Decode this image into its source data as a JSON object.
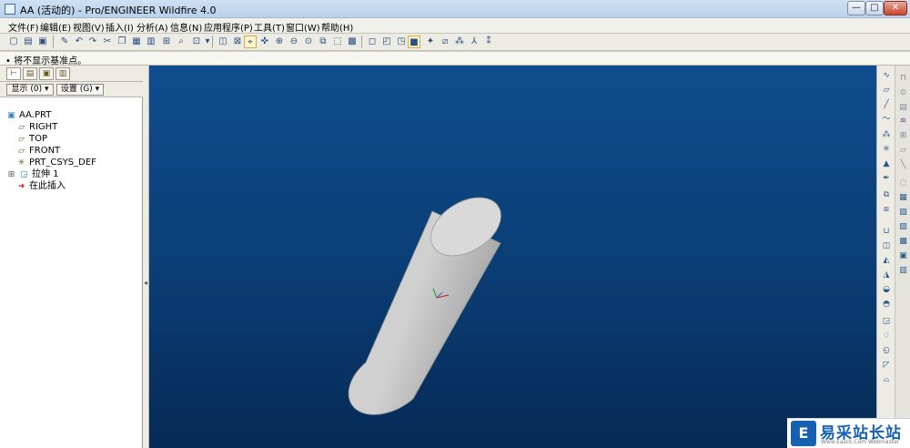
{
  "window": {
    "title": "AA (活动的) - Pro/ENGINEER Wildfire 4.0",
    "min": "—",
    "max": "□",
    "close": "✕"
  },
  "menu": [
    "文件(F)",
    "编辑(E)",
    "视图(V)",
    "插入(I)",
    "分析(A)",
    "信息(N)",
    "应用程序(P)",
    "工具(T)",
    "窗口(W)",
    "帮助(H)"
  ],
  "message": "• 将不显示基准点。",
  "navigator": {
    "show_label": "显示 (0) ▾",
    "settings_label": "设置 (G) ▾",
    "tree": [
      {
        "label": "AA.PRT",
        "icon": "part-icon"
      },
      {
        "label": "RIGHT",
        "icon": "datum-plane-icon"
      },
      {
        "label": "TOP",
        "icon": "datum-plane-icon"
      },
      {
        "label": "FRONT",
        "icon": "datum-plane-icon"
      },
      {
        "label": "PRT_CSYS_DEF",
        "icon": "csys-icon"
      },
      {
        "label": "拉伸 1",
        "icon": "extrude-icon"
      },
      {
        "label": "在此插入",
        "icon": "insert-here-icon"
      }
    ]
  },
  "colors": {
    "viewport_top": "#104d8e",
    "viewport_bottom": "#062a55",
    "cylinder_body": "#b5b5b5",
    "cylinder_cap": "#d6d6d6"
  },
  "watermark": {
    "logo": "E",
    "title": "易采站长站",
    "subtitle": "Www.Easck.Com  Webmaster"
  }
}
